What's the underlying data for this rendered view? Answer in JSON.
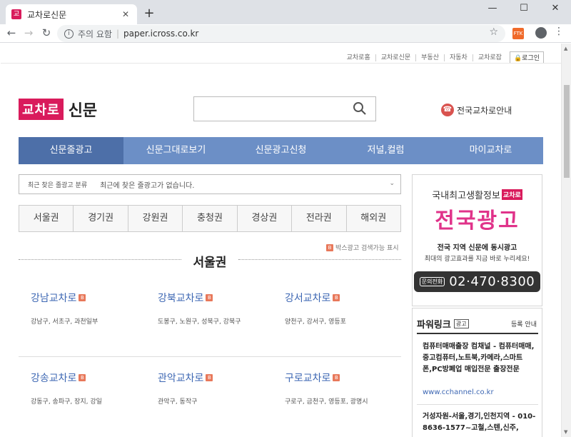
{
  "browser": {
    "tab_title": "교차로신문",
    "favicon": "교",
    "security_label": "주의 요함",
    "url": "paper.icross.co.kr",
    "ext_label": "FTK"
  },
  "util_nav": {
    "items": [
      "교차로홈",
      "교차로신문",
      "부동산",
      "자동차",
      "교차로잡"
    ],
    "login": "🔒로그인"
  },
  "header": {
    "logo_box": "교차로",
    "logo_text": "신문",
    "call_text": "전국교차로안내"
  },
  "gnb": [
    "신문줄광고",
    "신문그대로보기",
    "신문광고신청",
    "저널,컬럼",
    "마이교차로"
  ],
  "recent": {
    "label": "최근 찾은 줄광고 분류",
    "message": "최근에 찾은 줄광고가 없습니다."
  },
  "regions": [
    "서울권",
    "경기권",
    "강원권",
    "충청권",
    "경상권",
    "전라권",
    "해외권"
  ],
  "box_note": "박스광고 검색가능 표시",
  "badge": "B",
  "section_title": "서울권",
  "cards": [
    {
      "name": "강남교차로",
      "areas": "강남구, 서초구, 과천일부"
    },
    {
      "name": "강북교차로",
      "areas": "도봉구, 노원구, 성북구, 강북구"
    },
    {
      "name": "강서교차로",
      "areas": "양천구, 강서구, 영등포"
    },
    {
      "name": "강송교차로",
      "areas": "강동구, 송파구, 장지, 강일"
    },
    {
      "name": "관악교차로",
      "areas": "관악구, 동작구"
    },
    {
      "name": "구로교차로",
      "areas": "구로구, 금천구, 영등포, 광명시"
    }
  ],
  "side_ad": {
    "top": "국내최고생활정보",
    "mini": "교차로",
    "big": "전국광고",
    "line1": "전국 지역 신문에 동시광고",
    "line2": "최대의 광고효과를 지금 바로 누리세요!",
    "phone_label": "문의전화",
    "phone": "02·470·8300"
  },
  "power_link": {
    "title": "파워링크",
    "ad_tag": "광고",
    "register": "등록 안내",
    "items": [
      {
        "text": "컴퓨터매매출장 컴채널 - 컴퓨터매매,중고컴퓨터,노트북,카메라,스마트폰,PC방폐업 매입전문 출장전문",
        "url": "www.cchannel.co.kr"
      },
      {
        "text": "거성자원-서울,경기,인천지역 - 010-8636-1577~고철,스텐,신주,",
        "url": ""
      }
    ]
  }
}
